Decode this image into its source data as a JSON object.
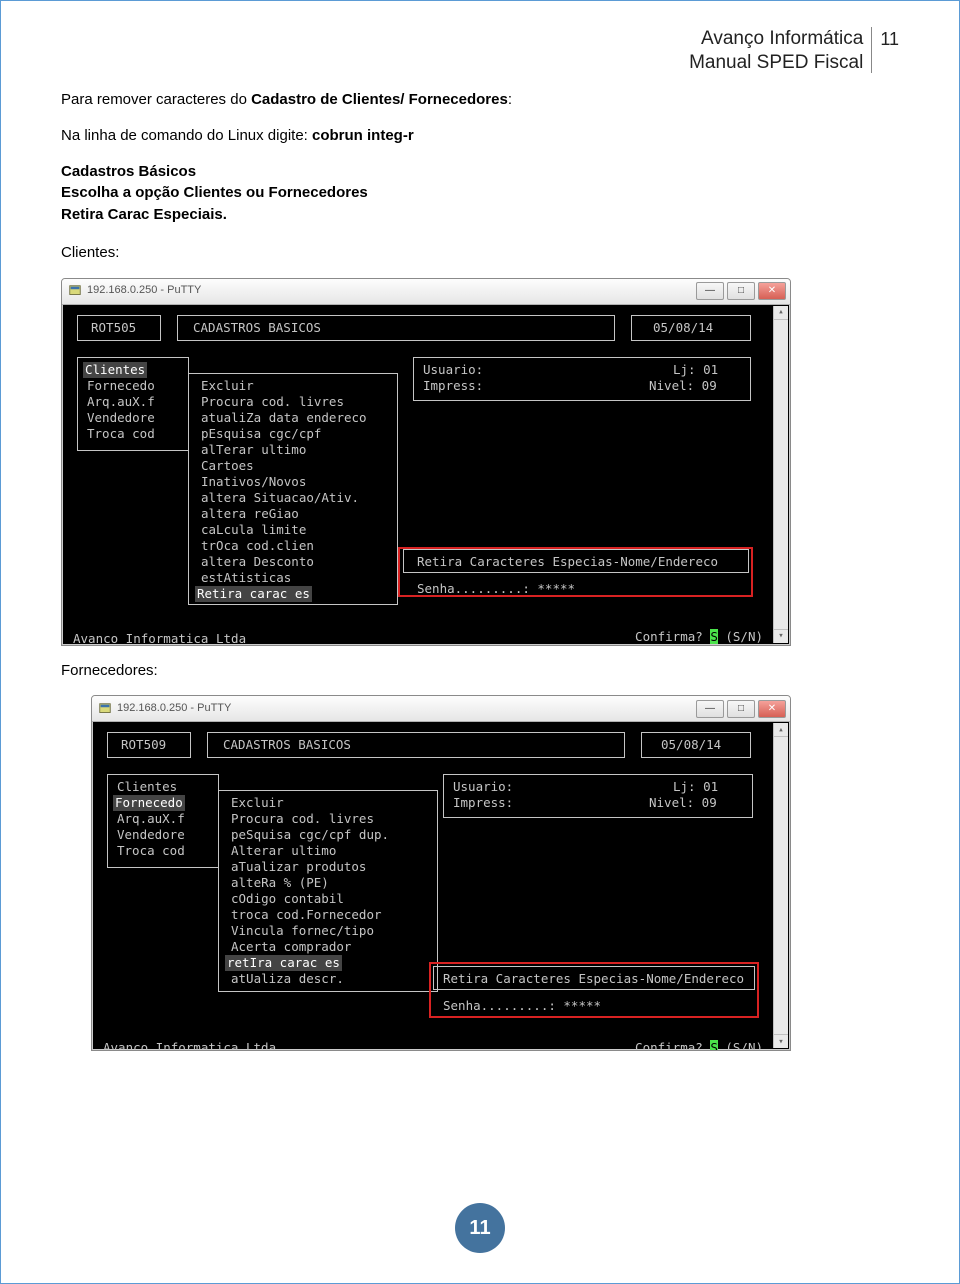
{
  "header": {
    "line1": "Avanço Informática",
    "line2": "Manual SPED Fiscal",
    "page_num": "11"
  },
  "text": {
    "p1_pre": "Para remover caracteres do ",
    "p1_bold": "Cadastro de Clientes/ Fornecedores",
    "p1_post": ":",
    "p2_pre": "Na linha de comando do Linux digite: ",
    "p2_bold": "cobrun integ-r",
    "h_cadastros": "Cadastros Básicos",
    "h_escolha": "Escolha a opção Clientes ou Fornecedores",
    "h_retira": "Retira Carac Especiais.",
    "lbl_clientes": "Clientes:",
    "lbl_fornecedores": "Fornecedores:"
  },
  "win1": {
    "title": "192.168.0.250 - PuTTY",
    "rot": "ROT505",
    "screen": "CADASTROS BASICOS",
    "date": "05/08/14",
    "left": [
      "Clientes",
      "Fornecedo",
      "Arq.auX.f",
      "Vendedore",
      "Troca cod"
    ],
    "mid": [
      "Excluir",
      "Procura cod. livres",
      "atualiZa data endereco",
      "pEsquisa cgc/cpf",
      "alTerar ultimo",
      "Cartoes",
      "Inativos/Novos",
      "altera Situacao/Ativ.",
      "altera reGiao",
      "caLcula limite",
      "trOca cod.clien",
      "altera Desconto",
      "estAtisticas",
      "Retira carac es"
    ],
    "usuario": "Usuario:",
    "impress": "Impress:",
    "lj": "Lj: 01",
    "nivel": "Nivel: 09",
    "popup": "Retira Caracteres Especias-Nome/Endereco",
    "senha": "Senha.........: *****",
    "confirma": "Confirma? ",
    "confirma_s": "S",
    "confirma_sn": " (S/N)",
    "footer": "Avanco Informatica Ltda"
  },
  "win2": {
    "title": "192.168.0.250 - PuTTY",
    "rot": "ROT509",
    "screen": "CADASTROS BASICOS",
    "date": "05/08/14",
    "left": [
      "Clientes",
      "Fornecedo",
      "Arq.auX.f",
      "Vendedore",
      "Troca cod"
    ],
    "mid": [
      "Excluir",
      "Procura cod. livres",
      "peSquisa cgc/cpf dup.",
      "Alterar ultimo",
      "aTualizar produtos",
      "alteRa % (PE)",
      "cOdigo contabil",
      "troca cod.Fornecedor",
      "Vincula fornec/tipo",
      "Acerta comprador",
      "retIra carac es",
      "atUaliza descr."
    ],
    "usuario": "Usuario:",
    "impress": "Impress:",
    "lj": "Lj: 01",
    "nivel": "Nivel: 09",
    "popup": "Retira Caracteres Especias-Nome/Endereco",
    "senha": "Senha.........: *****",
    "confirma": "Confirma? ",
    "confirma_s": "S",
    "confirma_sn": " (S/N)",
    "footer": "Avanco Informatica Ltda"
  },
  "footer_page": "11"
}
